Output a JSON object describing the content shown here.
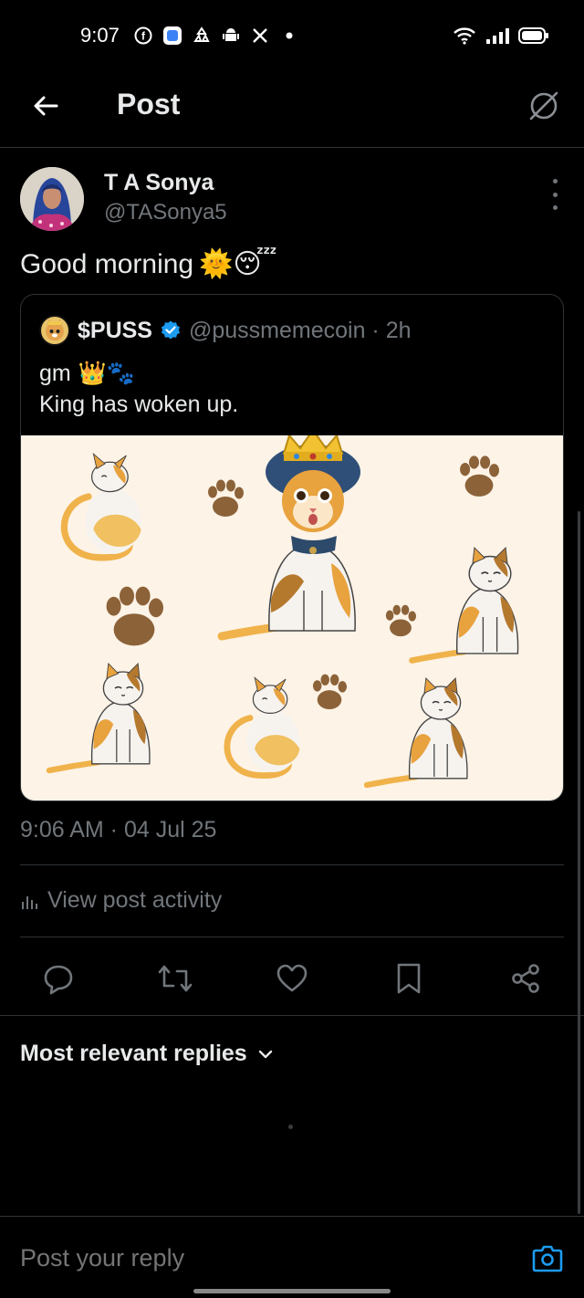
{
  "status_bar": {
    "time": "9:07",
    "icons": [
      "facebook-icon",
      "app-icon",
      "recycle-icon",
      "android-icon",
      "x-icon",
      "dot-icon"
    ],
    "right_icons": [
      "wifi-icon",
      "signal-icon",
      "battery-icon"
    ]
  },
  "header": {
    "title": "Post"
  },
  "post": {
    "author_name": "T A Sonya",
    "author_handle": "@TASonya5",
    "text": "Good morning",
    "emoji": "🌞😴",
    "timestamp": "9:06 AM · 04 Jul 25",
    "activity_label": "View post activity"
  },
  "quote": {
    "name": "$PUSS",
    "handle": "@pussmemecoin · 2h",
    "line1": "gm",
    "line1_emoji": "👑🐾",
    "line2": "King has woken up."
  },
  "actions": [
    "reply-icon",
    "repost-icon",
    "like-icon",
    "bookmark-icon",
    "share-icon"
  ],
  "replies": {
    "sort_label": "Most relevant replies"
  },
  "reply_bar": {
    "placeholder": "Post your reply"
  },
  "colors": {
    "background": "#000000",
    "text": "#e7e9ea",
    "muted": "#71767b",
    "border": "#2f3336",
    "accent": "#1d9bf0",
    "quote_image_bg": "#fdf3e6"
  }
}
